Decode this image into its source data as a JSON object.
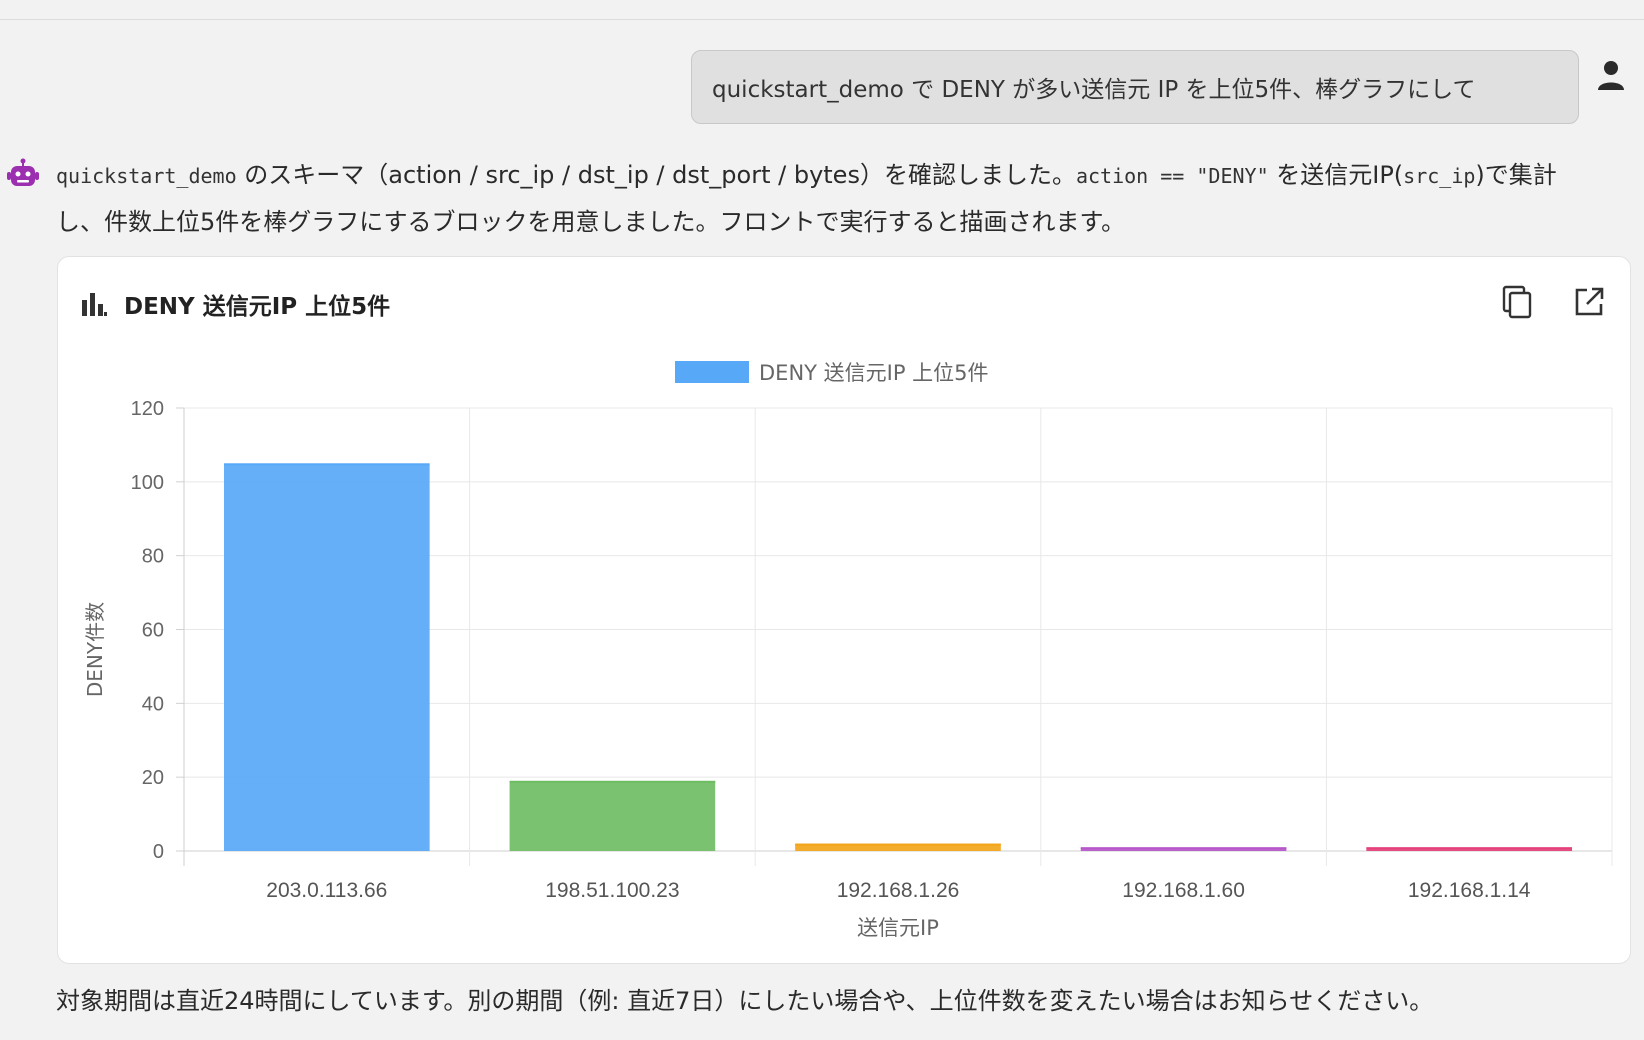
{
  "user_message": "quickstart_demo で DENY が多い送信元 IP を上位5件、棒グラフにして",
  "assistant": {
    "intro_parts": {
      "p1": "quickstart_demo",
      "p2": " のスキーマ（action / src_ip / dst_ip / dst_port / bytes）を確認しました。",
      "p3": "action == \"DENY\"",
      "p4": " を送信元IP(",
      "p5": "src_ip",
      "p6": ")で集計し、件数上位5件を棒グラフにするブロックを用意しました。フロントで実行すると描画されます。"
    },
    "outro": "対象期間は直近24時間にしています。別の期間（例: 直近7日）にしたい場合や、上位件数を変えたい場合はお知らせください。"
  },
  "card": {
    "title": "DENY 送信元IP 上位5件",
    "copy_icon": "copy-icon",
    "open_icon": "open-external-icon"
  },
  "chart_data": {
    "type": "bar",
    "legend": "DENY 送信元IP 上位5件",
    "legend_color": "#57a8f7",
    "categories": [
      "203.0.113.66",
      "198.51.100.23",
      "192.168.1.26",
      "192.168.1.60",
      "192.168.1.14"
    ],
    "values": [
      105,
      19,
      2,
      1,
      1
    ],
    "colors": [
      "#57a8f7",
      "#6fbd63",
      "#f2a51a",
      "#b557c9",
      "#e4407a"
    ],
    "xlabel": "送信元IP",
    "ylabel": "DENY件数",
    "ylim": [
      0,
      120
    ],
    "yticks": [
      0,
      20,
      40,
      60,
      80,
      100,
      120
    ],
    "grid": true,
    "legend_position": "top-center"
  }
}
